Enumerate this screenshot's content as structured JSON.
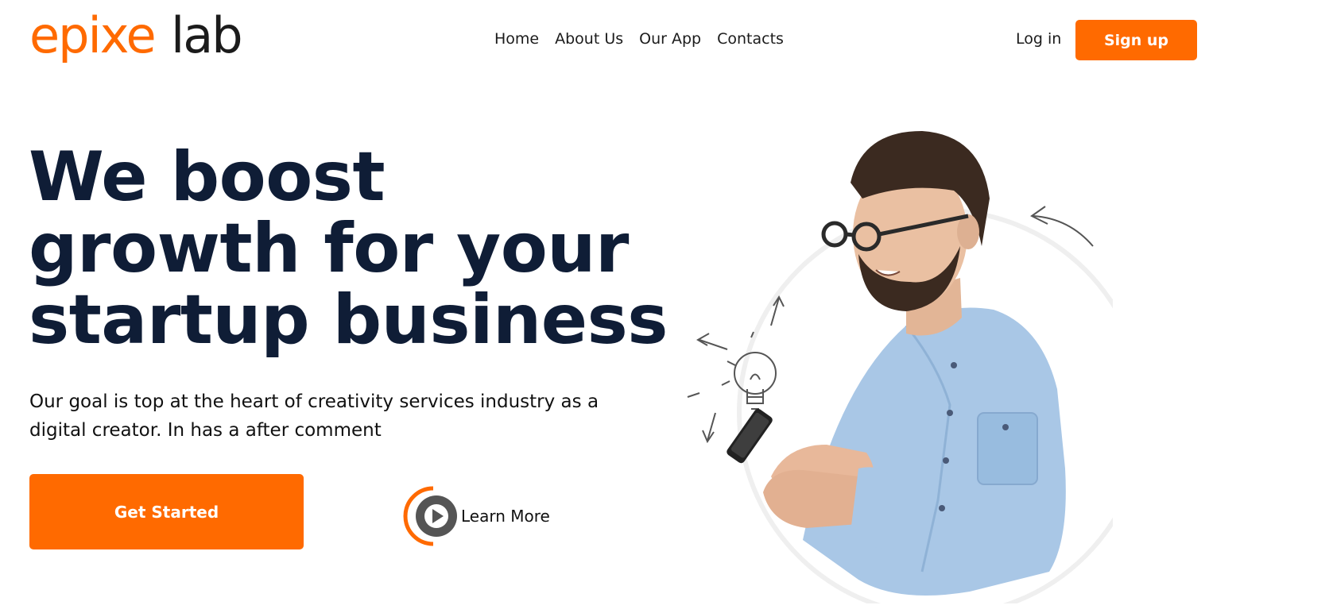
{
  "brand": {
    "logo_text_orange": "epixe",
    "logo_text_dark": "lab",
    "accent_color": "#ff6a00",
    "dark_color": "#0f1d36"
  },
  "nav": {
    "items": [
      {
        "label": "Home"
      },
      {
        "label": "About Us"
      },
      {
        "label": "Our App"
      },
      {
        "label": "Contacts"
      }
    ]
  },
  "auth": {
    "login_label": "Log in",
    "signup_label": "Sign up"
  },
  "hero": {
    "headline_lines": [
      "We boost",
      "growth for your",
      "startup business"
    ],
    "subtext": "Our goal is top at the heart of creativity services industry as a digital creator. In has a after comment",
    "cta_label": "Get Started",
    "learn_more_label": "Learn More"
  },
  "icons": {
    "play": "play-icon",
    "lightbulb": "lightbulb-icon",
    "arrow": "arrow-icon"
  }
}
